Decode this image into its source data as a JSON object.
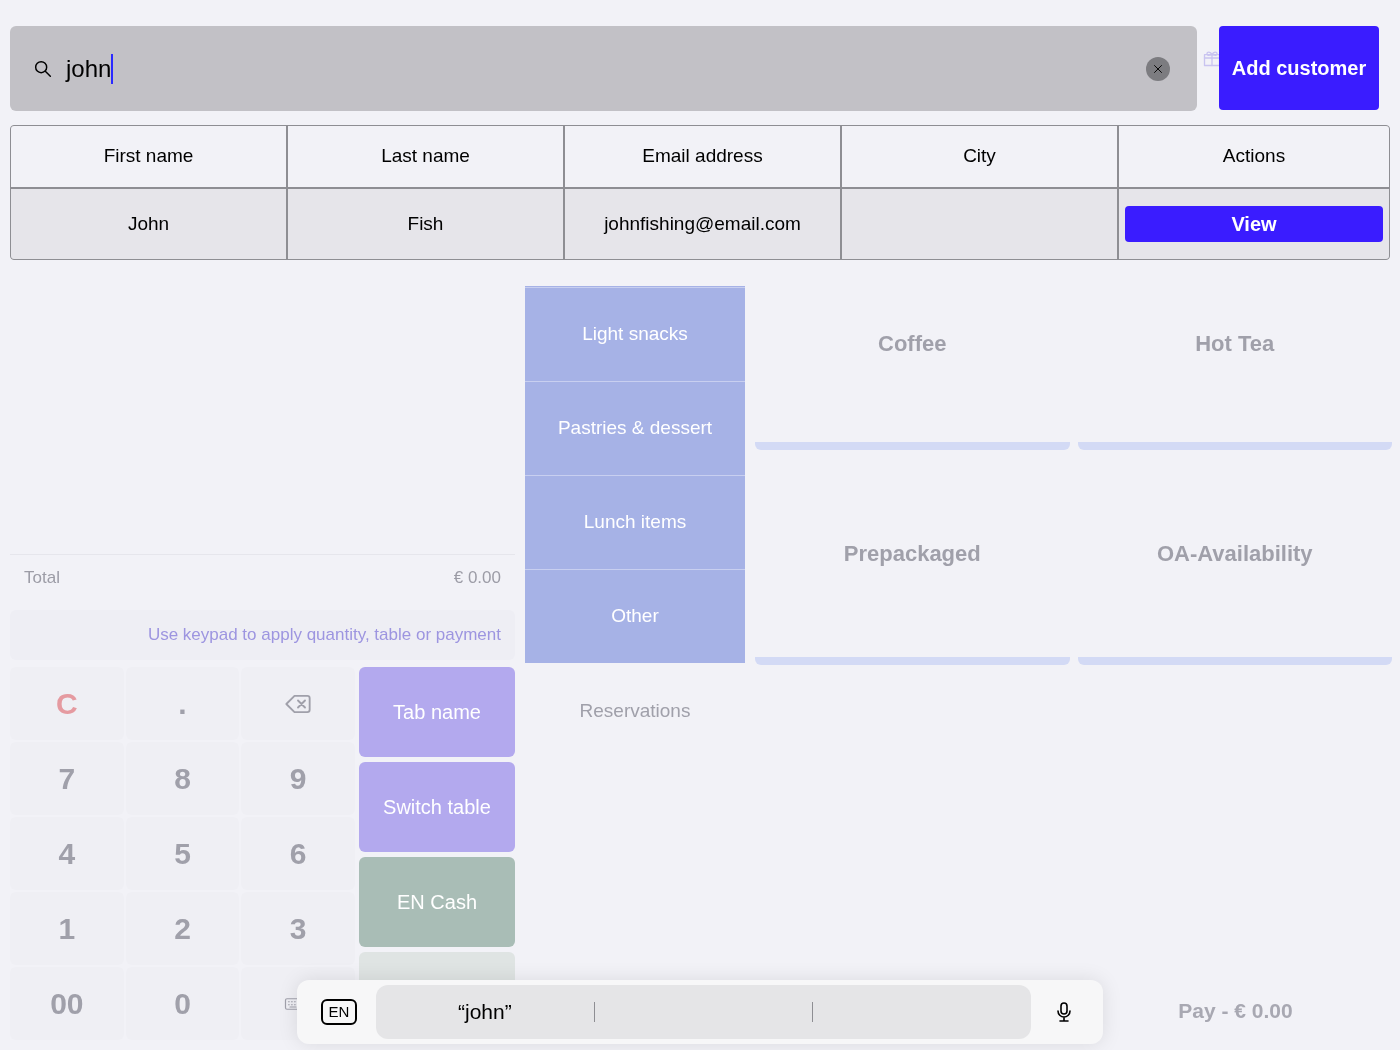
{
  "background": {
    "order": {
      "total_label": "Total",
      "total": "€ 0.00",
      "hint": "Use keypad to apply quantity, table or payment"
    },
    "keypad": [
      {
        "kind": "clear",
        "label": "C"
      },
      {
        "kind": "digit",
        "label": "."
      },
      {
        "kind": "backspace"
      },
      {
        "kind": "digit",
        "label": "7"
      },
      {
        "kind": "digit",
        "label": "8"
      },
      {
        "kind": "digit",
        "label": "9"
      },
      {
        "kind": "digit",
        "label": "4"
      },
      {
        "kind": "digit",
        "label": "5"
      },
      {
        "kind": "digit",
        "label": "6"
      },
      {
        "kind": "digit",
        "label": "1"
      },
      {
        "kind": "digit",
        "label": "2"
      },
      {
        "kind": "digit",
        "label": "3"
      },
      {
        "kind": "digit",
        "label": "00"
      },
      {
        "kind": "digit",
        "label": "0"
      },
      {
        "kind": "keyboard"
      }
    ],
    "action_buttons": [
      {
        "label": "Tab name",
        "color": "#b3a9ee"
      },
      {
        "label": "Switch table",
        "color": "#b3a9ee"
      },
      {
        "label": "EN Cash",
        "color": "#a9bdb6"
      }
    ],
    "categories": [
      "Light snacks",
      "Pastries & dessert",
      "Lunch items",
      "Other"
    ],
    "reservations": "Reservations",
    "products": [
      "Coffee",
      "Hot Tea",
      "Prepackaged",
      "OA-Availability"
    ],
    "pay": "Pay - € 0.00"
  },
  "search": {
    "value": "john"
  },
  "add_button": "Add customer",
  "table": {
    "columns": [
      "First name",
      "Last name",
      "Email address",
      "City",
      "Actions"
    ],
    "rows": [
      {
        "first_name": "John",
        "last_name": "Fish",
        "email": "johnfishing@email.com",
        "action": "View"
      }
    ]
  },
  "keyboard_bar": {
    "language": "EN",
    "suggestions": [
      "“john”"
    ]
  }
}
